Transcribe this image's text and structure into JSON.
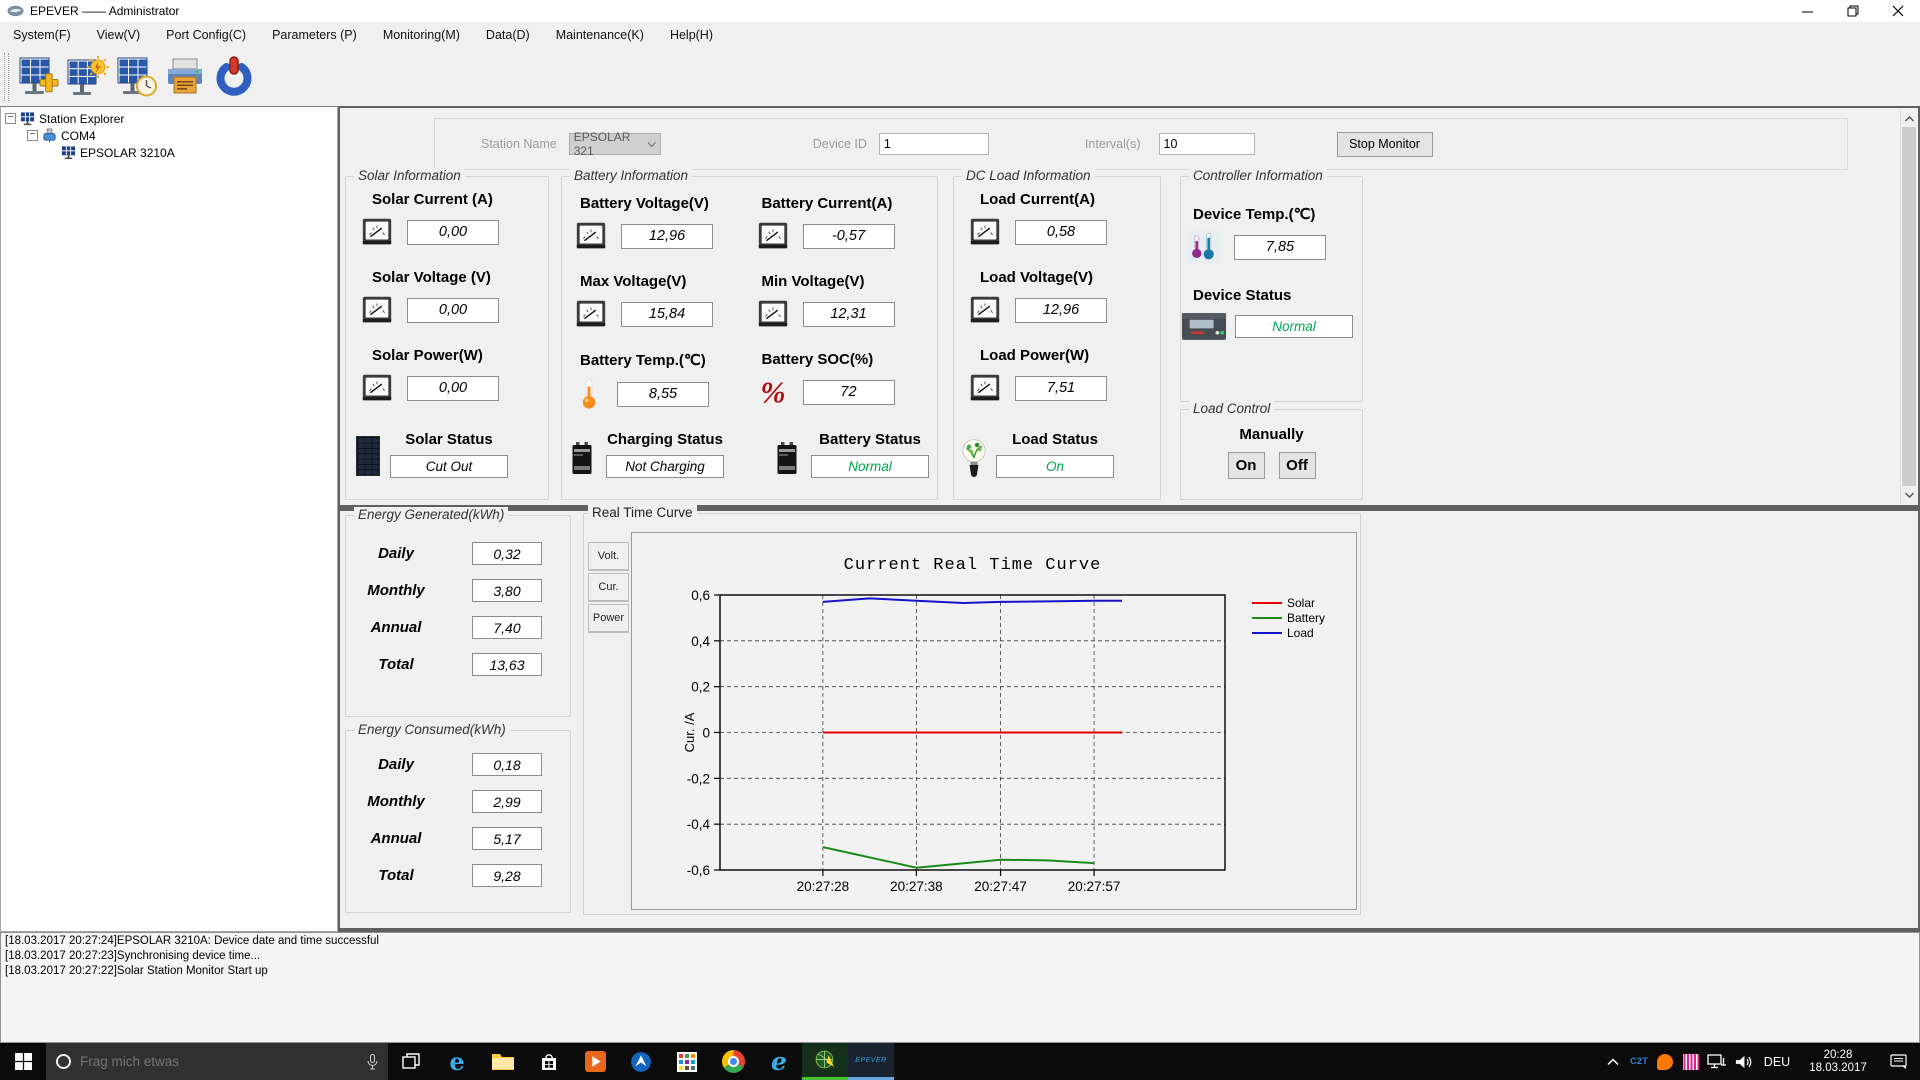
{
  "window": {
    "title": "EPEVER —— Administrator"
  },
  "menu": {
    "items": [
      "System(F)",
      "View(V)",
      "Port Config(C)",
      "Parameters (P)",
      "Monitoring(M)",
      "Data(D)",
      "Maintenance(K)",
      "Help(H)"
    ]
  },
  "toolbar": {
    "icons": [
      "add-station-icon",
      "station-parameters-icon",
      "station-time-icon",
      "print-icon",
      "power-exit-icon"
    ]
  },
  "tree": {
    "root_label": "Station Explorer",
    "port_label": "COM4",
    "device_label": "EPSOLAR 3210A"
  },
  "monitor_bar": {
    "station_name_label": "Station Name",
    "station_name_value": "EPSOLAR 321",
    "device_id_label": "Device ID",
    "device_id_value": "1",
    "interval_label": "Interval(s)",
    "interval_value": "10",
    "stop_button_label": "Stop Monitor"
  },
  "solar": {
    "title": "Solar Information",
    "current_label": "Solar Current (A)",
    "current_value": "0,00",
    "voltage_label": "Solar Voltage (V)",
    "voltage_value": "0,00",
    "power_label": "Solar Power(W)",
    "power_value": "0,00",
    "status_label": "Solar Status",
    "status_value": "Cut Out"
  },
  "battery": {
    "title": "Battery Information",
    "voltage_label": "Battery Voltage(V)",
    "voltage_value": "12,96",
    "current_label": "Battery Current(A)",
    "current_value": "-0,57",
    "max_voltage_label": "Max Voltage(V)",
    "max_voltage_value": "15,84",
    "min_voltage_label": "Min Voltage(V)",
    "min_voltage_value": "12,31",
    "temp_label": "Battery Temp.(℃)",
    "temp_value": "8,55",
    "soc_label": "Battery SOC(%)",
    "soc_value": "72",
    "charging_status_label": "Charging Status",
    "charging_status_value": "Not Charging",
    "battery_status_label": "Battery Status",
    "battery_status_value": "Normal"
  },
  "dc_load": {
    "title": "DC Load Information",
    "current_label": "Load Current(A)",
    "current_value": "0,58",
    "voltage_label": "Load Voltage(V)",
    "voltage_value": "12,96",
    "power_label": "Load Power(W)",
    "power_value": "7,51",
    "status_label": "Load Status",
    "status_value": "On"
  },
  "controller": {
    "title": "Controller Information",
    "temp_label": "Device Temp.(℃)",
    "temp_value": "7,85",
    "status_label": "Device Status",
    "status_value": "Normal"
  },
  "load_control": {
    "title": "Load Control",
    "manually_label": "Manually",
    "on_label": "On",
    "off_label": "Off"
  },
  "energy_generated": {
    "title": "Energy Generated(kWh)",
    "rows": [
      {
        "label": "Daily",
        "value": "0,32"
      },
      {
        "label": "Monthly",
        "value": "3,80"
      },
      {
        "label": "Annual",
        "value": "7,40"
      },
      {
        "label": "Total",
        "value": "13,63"
      }
    ]
  },
  "energy_consumed": {
    "title": "Energy Consumed(kWh)",
    "rows": [
      {
        "label": "Daily",
        "value": "0,18"
      },
      {
        "label": "Monthly",
        "value": "2,99"
      },
      {
        "label": "Annual",
        "value": "5,17"
      },
      {
        "label": "Total",
        "value": "9,28"
      }
    ]
  },
  "curve_panel": {
    "title": "Real Time Curve",
    "tabs": [
      {
        "label": "Volt."
      },
      {
        "label": "Cur."
      },
      {
        "label": "Power"
      }
    ]
  },
  "chart_data": {
    "type": "line",
    "title": "Current Real Time Curve",
    "xlabel": "",
    "ylabel": "Cur. /A",
    "ylim": [
      -0.6,
      0.6
    ],
    "grid": true,
    "legend_position": "right",
    "x_range_seconds": [
      17,
      71
    ],
    "y_ticks": [
      {
        "label": "0,6",
        "value": 0.6
      },
      {
        "label": "0,4",
        "value": 0.4
      },
      {
        "label": "0,2",
        "value": 0.2
      },
      {
        "label": "0",
        "value": 0.0
      },
      {
        "label": "-0,2",
        "value": -0.2
      },
      {
        "label": "-0,4",
        "value": -0.4
      },
      {
        "label": "-0,6",
        "value": -0.6
      }
    ],
    "x_ticks": [
      {
        "label": "20:27:28",
        "second": 28
      },
      {
        "label": "20:27:38",
        "second": 38
      },
      {
        "label": "20:27:47",
        "second": 47
      },
      {
        "label": "20:27:57",
        "second": 57
      }
    ],
    "series": [
      {
        "name": "Solar",
        "color": "#e60000",
        "x_seconds": [
          28,
          60
        ],
        "values": [
          0,
          0
        ]
      },
      {
        "name": "Battery",
        "color": "#1a8a1a",
        "x_seconds": [
          28,
          38,
          47,
          52,
          57
        ],
        "values": [
          -0.5,
          -0.59,
          -0.555,
          -0.558,
          -0.57
        ]
      },
      {
        "name": "Load",
        "color": "#1414cc",
        "x_seconds": [
          28,
          33,
          38,
          43,
          47,
          52,
          57,
          60
        ],
        "values": [
          0.57,
          0.585,
          0.575,
          0.565,
          0.57,
          0.572,
          0.575,
          0.575
        ]
      }
    ]
  },
  "log": {
    "lines": [
      "[18.03.2017 20:27:24]EPSOLAR 3210A: Device date and time successful",
      "[18.03.2017 20:27:23]Synchronising device time...",
      "[18.03.2017 20:27:22]Solar Station Monitor Start up"
    ]
  },
  "taskbar": {
    "search_placeholder": "Frag mich etwas",
    "c2t": "C2T",
    "epever_label": "EPEVER",
    "language": "DEU",
    "time": "20:28",
    "date": "18.03.2017"
  },
  "colors": {
    "status_green": "#00A651",
    "solar_series": "#e60000",
    "battery_series": "#1a8a1a",
    "load_series": "#1414cc",
    "active_task_underline_green": "#46c433",
    "task_underline_blue": "#6aa7e0"
  }
}
